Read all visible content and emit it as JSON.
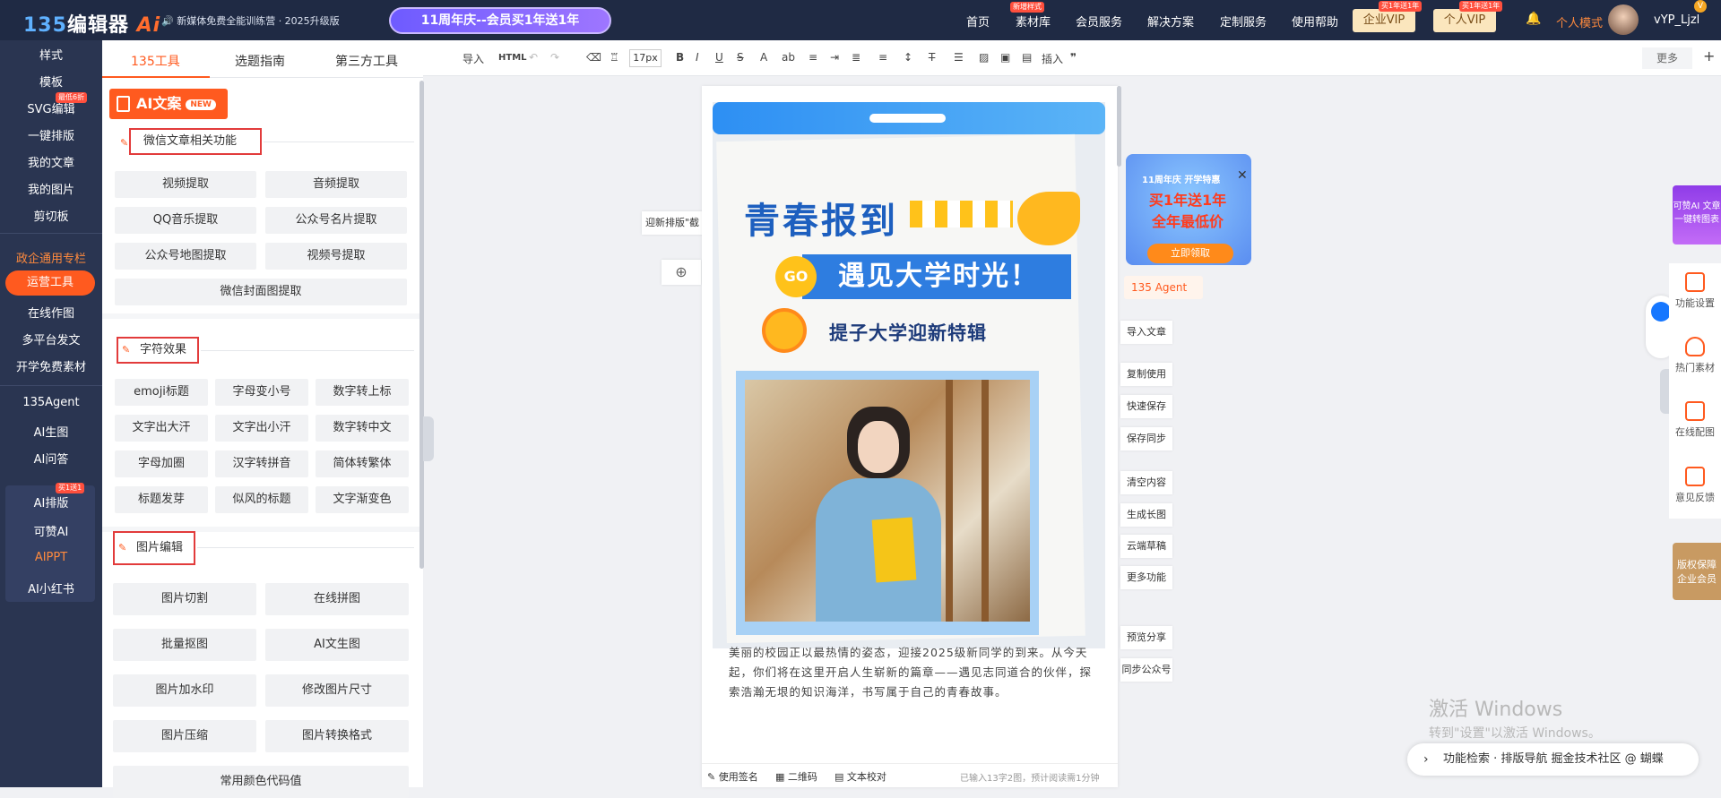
{
  "header": {
    "logo_prefix": "135",
    "logo_main": "编辑器",
    "logo_ai": "Ai",
    "promo_text": "🔊 新媒体免费全能训练营 · 2025升级版",
    "anniversary_pill": "11周年庆--会员买1年送1年",
    "nav": [
      "首页",
      "素材库",
      "会员服务",
      "解决方案",
      "定制服务",
      "使用帮助"
    ],
    "nav_new_badge": "新增样式",
    "enterprise_vip": "企业VIP",
    "personal_vip": "个人VIP",
    "vip_badge": "买1年送1年",
    "mode": "个人模式",
    "username": "vYP_Ljzl",
    "user_badge": "V"
  },
  "leftnav": {
    "items": [
      "样式",
      "模板",
      "SVG编辑",
      "一键排版",
      "我的文章",
      "我的图片",
      "剪切板",
      "政企通用专栏",
      "运营工具",
      "在线作图",
      "多平台发文",
      "开学免费素材",
      "135Agent",
      "AI生图",
      "AI问答",
      "AI排版",
      "可赞AI",
      "AIPPT",
      "AI小红书"
    ],
    "svg_badge": "最低6折",
    "ai_badge": "买1送1"
  },
  "panel": {
    "tabs": [
      "135工具",
      "选题指南",
      "第三方工具"
    ],
    "ai_badge": "AI文案",
    "ai_new": "NEW",
    "section1": "微信文章相关功能",
    "s1_buttons": [
      "视频提取",
      "音频提取",
      "QQ音乐提取",
      "公众号名片提取",
      "公众号地图提取",
      "视频号提取",
      "微信封面图提取"
    ],
    "section2": "字符效果",
    "s2_buttons": [
      "emoji标题",
      "字母变小号",
      "数字转上标",
      "文字出大汗",
      "文字出小汗",
      "数字转中文",
      "字母加圈",
      "汉字转拼音",
      "简体转繁体",
      "标题发芽",
      "似风的标题",
      "文字渐变色"
    ],
    "section3": "图片编辑",
    "s3_buttons": [
      "图片切割",
      "在线拼图",
      "批量抠图",
      "AI文生图",
      "图片加水印",
      "修改图片尺寸",
      "图片压缩",
      "图片转换格式",
      "常用颜色代码值"
    ]
  },
  "toolbar": {
    "import": "导入",
    "html": "HTML",
    "fontsize": "17px",
    "insert": "插入",
    "more": "更多"
  },
  "editor": {
    "floating_label": "迎新排版\"截",
    "floating_plus": "⊕",
    "poster_title": "青春报到",
    "poster_go": "GO",
    "poster_banner": "遇见大学时光！",
    "poster_sub": "提子大学迎新特辑",
    "paragraph": "美丽的校园正以最热情的姿态，迎接2025级新同学的到来。从今天起，你们将在这里开启人生崭新的篇章——遇见志同道合的伙伴，探索浩瀚无垠的知识海洋，书写属于自己的青春故事。",
    "footer_items": [
      "使用签名",
      "二维码",
      "文本校对"
    ],
    "footer_status": "已输入13字2图，预计阅读需1分钟"
  },
  "right_menu": {
    "agent": "135 Agent",
    "items": [
      "导入文章",
      "复制使用",
      "快速保存",
      "保存同步",
      "清空内容",
      "生成长图",
      "云端草稿",
      "更多功能",
      "预览分享",
      "同步公众号"
    ]
  },
  "ad": {
    "ribbon": "11周年庆 开学特惠",
    "line1": "买1年送1年",
    "line2": "全年最低价",
    "button": "立即领取",
    "close": "✕"
  },
  "rightbar": {
    "promo_top": "可赞AI 文章一键转图表",
    "items": [
      "功能设置",
      "热门素材",
      "在线配图",
      "意见反馈"
    ],
    "promo_bottom": "版权保障 企业会员"
  },
  "watermark": {
    "line1": "激活 Windows",
    "line2": "转到\"设置\"以激活 Windows。"
  },
  "bottom_bar": {
    "text": "功能检索 · 排版导航  掘金技术社区 @ 蝴蝶"
  },
  "colors": {
    "accent": "#ff5a1f",
    "nav_bg": "#1f2a44",
    "sidebar_bg": "#2a3551",
    "poster_blue": "#2e7de0"
  }
}
